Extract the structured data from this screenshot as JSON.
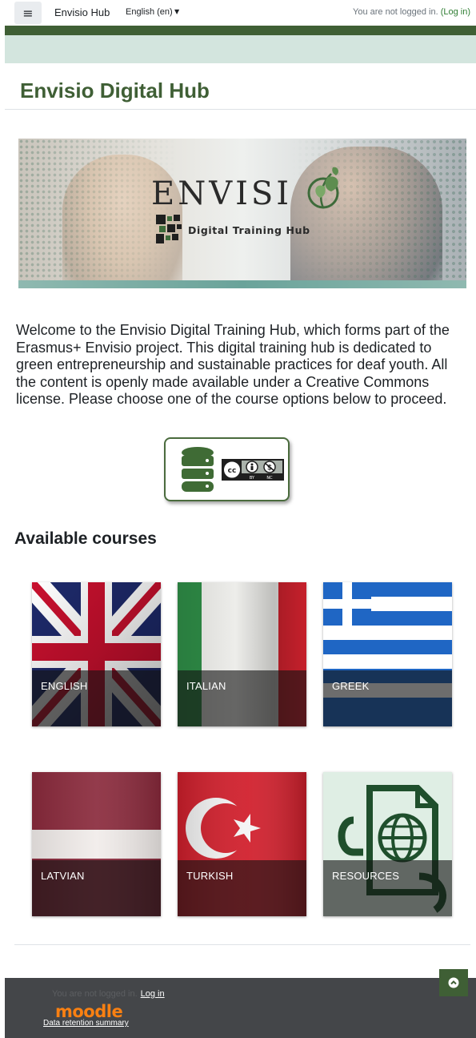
{
  "navbar": {
    "menu_icon": "hamburger-menu-icon",
    "brand": "Envisio Hub",
    "language": "English (en)",
    "login_text": "You are not logged in.",
    "login_link": "(Log in)"
  },
  "page": {
    "title": "Envisio Digital Hub"
  },
  "banner": {
    "logo_text": "ENVISI",
    "subtitle": "Digital Training Hub"
  },
  "welcome_text": "Welcome to the Envisio Digital Training Hub, which forms part of the Erasmus+ Envisio project. This digital training hub is dedicated to green entrepreneurship and sustainable practices for deaf youth. All the content is openly made available under a Creative Commons license. Please choose one of the course options below to proceed.",
  "license": {
    "badge_text_1": "BY",
    "badge_text_2": "NC"
  },
  "courses": {
    "title": "Available courses",
    "items": [
      {
        "label": "ENGLISH"
      },
      {
        "label": "ITALIAN"
      },
      {
        "label": "GREEK"
      },
      {
        "label": "LATVIAN"
      },
      {
        "label": "TURKISH"
      },
      {
        "label": "RESOURCES"
      }
    ]
  },
  "footer": {
    "login_text": "You are not logged in.",
    "login_link": "Log in",
    "logo": "moodle",
    "data_retention": "Data retention summary"
  },
  "colors": {
    "brand_green": "#3f5f35",
    "mint": "#d3e5de",
    "footer_bg": "#444649",
    "moodle_orange": "#f98012"
  }
}
